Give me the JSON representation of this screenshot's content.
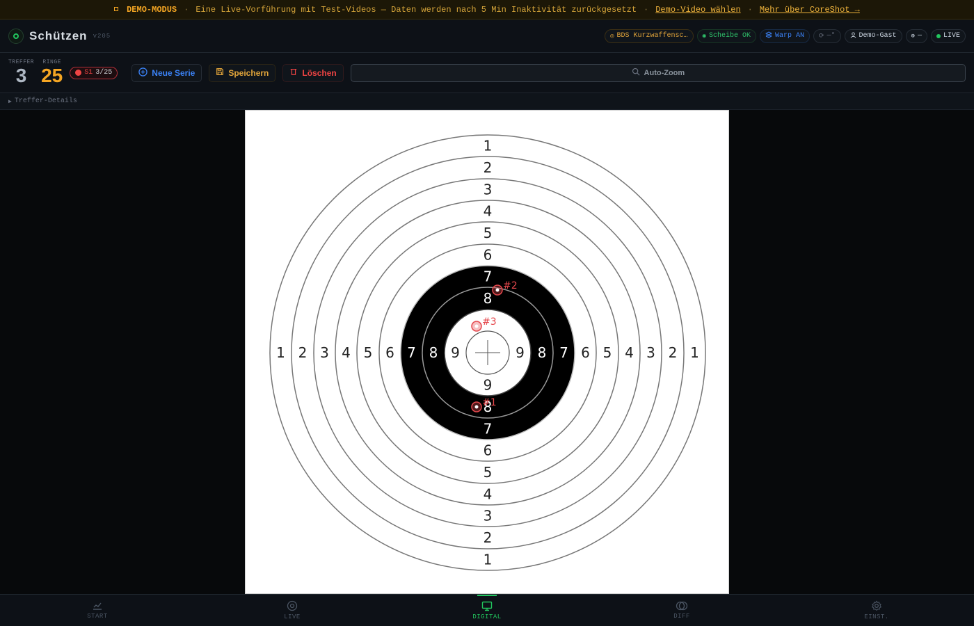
{
  "banner": {
    "tag": "DEMO-MODUS",
    "text": "Eine Live-Vorführung mit Test-Videos — Daten werden nach 5 Min Inaktivität zurückgesetzt",
    "link_video": "Demo-Video wählen",
    "link_more": "Mehr über CoreShot →"
  },
  "header": {
    "title": "Schützen",
    "version": "v205",
    "pills": {
      "discipline": "BDS Kurzwaffensc…",
      "target": "Scheibe OK",
      "warp": "Warp AN",
      "sync": "—°",
      "user": "Demo-Gast",
      "crosshair": "—",
      "live": "LIVE"
    }
  },
  "toolbar": {
    "hits_label": "TREFFER",
    "hits_value": "3",
    "rings_label": "RINGE",
    "rings_value": "25",
    "series_label": "S1",
    "series_count": "3/25",
    "new_series": "Neue Serie",
    "save": "Speichern",
    "delete": "Löschen",
    "auto_zoom": "Auto-Zoom"
  },
  "details": {
    "label": "Treffer-Details"
  },
  "target": {
    "ring_numbers": [
      "1",
      "2",
      "3",
      "4",
      "5",
      "6",
      "7",
      "8",
      "9"
    ],
    "shots": [
      {
        "label": "#1",
        "ring": 8
      },
      {
        "label": "#2",
        "ring": 8
      },
      {
        "label": "#3",
        "ring": 9
      }
    ]
  },
  "nav": {
    "start": "START",
    "live": "LIVE",
    "digital": "DIGITAL",
    "diff": "DIFF",
    "settings": "EINST."
  },
  "colors": {
    "accent_green": "#22c55e",
    "accent_amber": "#f5a623",
    "accent_red": "#ef4444",
    "accent_blue": "#3b82f6"
  }
}
